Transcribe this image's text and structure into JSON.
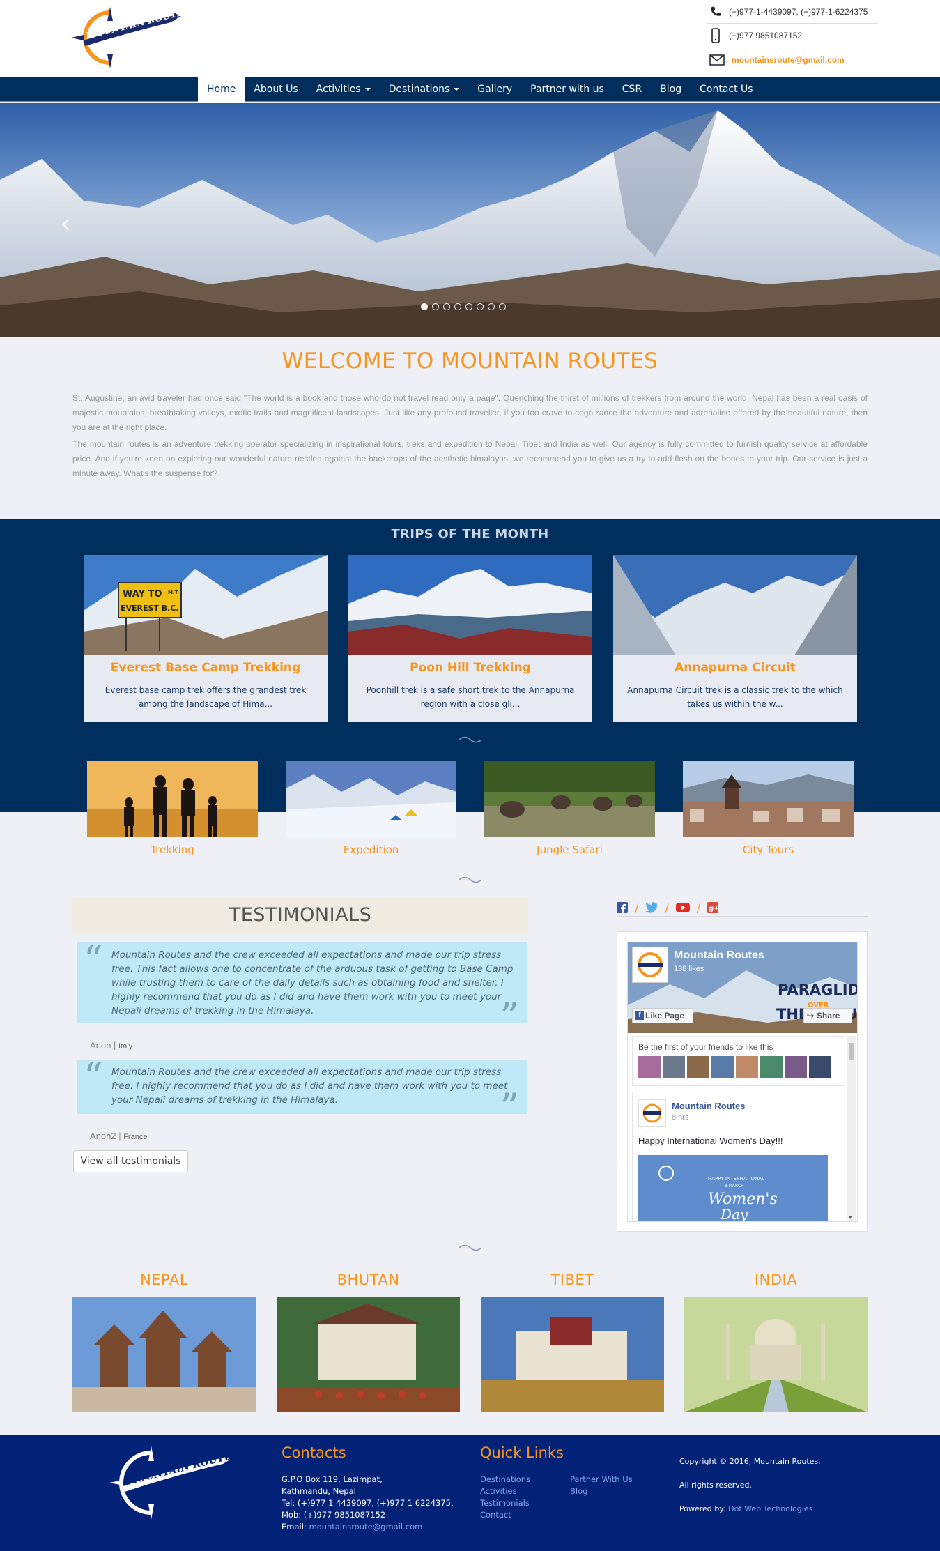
{
  "header": {
    "logo_text": "MOUNTAIN ROUTES",
    "phone_land": "(+)977-1-4439097, (+)977-1-6224375",
    "phone_mobile": "(+)977 9851087152",
    "email": "mountainsroute@gmail.com"
  },
  "nav": {
    "items": [
      {
        "label": "Home",
        "active": true
      },
      {
        "label": "About Us"
      },
      {
        "label": "Activities",
        "dropdown": true
      },
      {
        "label": "Destinations",
        "dropdown": true
      },
      {
        "label": "Gallery"
      },
      {
        "label": "Partner with us"
      },
      {
        "label": "CSR"
      },
      {
        "label": "Blog"
      },
      {
        "label": "Contact Us"
      }
    ]
  },
  "hero": {
    "slides": 8,
    "active_slide": 1
  },
  "welcome": {
    "title": "WELCOME TO MOUNTAIN ROUTES",
    "para1": "St. Augustine, an avid traveler had once said \"The world is a book and those who do not travel read only a page\". Quenching the thirst of millions of trekkers from around the world, Nepal has been a real oasis of majestic mountains, breathtaking valleys, exotic trails and magnificent landscapes. Just like any profound traveller, if you too crave to cognizance the adventure and adrenaline offered by the beautiful nature, then you are at the right place.",
    "para2": "The mountain routes is an adventure trekking operator specializing in inspirational tours, treks and expedition to Nepal, Tibet and India as well. Our agency is fully committed to furnish quality service at affordable price. And if you're keen on exploring our wonderful nature nestled against the backdrops of the aesthetic himalayas, we recommend you to give us a try to add flesh on the bones to your trip. Our service is just a minute away. What's the suspense for?"
  },
  "trips": {
    "title": "TRIPS OF THE MONTH",
    "items": [
      {
        "title": "Everest Base Camp Trekking",
        "desc": "Everest base camp trek offers the grandest trek among the landscape of Hima...",
        "sign_line1": "WAY TO",
        "sign_line2": "EVEREST B.C.",
        "sign_mt": "M.T"
      },
      {
        "title": "Poon Hill Trekking",
        "desc": "Poonhill trek is a safe short trek to the Annapurna region with a close gli..."
      },
      {
        "title": "Annapurna Circuit",
        "desc": "Annapurna Circuit trek is a classic trek to the which takes us within the w..."
      }
    ]
  },
  "activities": [
    {
      "label": "Trekking"
    },
    {
      "label": "Expedition"
    },
    {
      "label": "Jungle Safari"
    },
    {
      "label": "City Tours"
    }
  ],
  "testimonials": {
    "title": "TESTIMONIALS",
    "items": [
      {
        "text": "Mountain Routes and the crew exceeded all expectations and made our trip stress free. This fact allows one to concentrate of the arduous task of getting to Base Camp while trusting them to care of the daily details such as obtaining food and shelter. I highly recommend that you do as I did and have them work with you to meet your Nepali dreams of trekking in the Himalaya.",
        "author": "Anon",
        "country": "Italy"
      },
      {
        "text": "Mountain Routes and the crew exceeded all expectations and made our trip stress free. I highly recommend that you do as I did and have them work with you to meet your Nepali dreams of trekking in the Himalaya.",
        "author": "Anon2",
        "country": "France"
      }
    ],
    "view_all": "View all testimonials"
  },
  "facebook": {
    "page_name": "Mountain Routes",
    "likes": "138 likes",
    "like_btn": "Like Page",
    "share_btn": "Share",
    "cover_text1": "PARAGLIDE",
    "cover_text2": "OVER",
    "cover_text3": "THE CLOUDS",
    "friends_text": "Be the first of your friends to like this",
    "post_author": "Mountain Routes",
    "post_time": "8 hrs",
    "post_text": "Happy International Women's Day!!!",
    "post_img_text1": "HAPPY INTERNATIONAL",
    "post_img_text2": "8 MARCH",
    "post_img_text3": "Women's",
    "post_img_text4": "Day"
  },
  "countries": [
    {
      "label": "NEPAL"
    },
    {
      "label": "BHUTAN"
    },
    {
      "label": "TIBET"
    },
    {
      "label": "INDIA"
    }
  ],
  "footer": {
    "contacts_title": "Contacts",
    "address1": "G.P.O Box 119, Lazimpat,",
    "address2": "Kathmandu, Nepal",
    "tel": "Tel: (+)977 1 4439097, (+)977 1 6224375,",
    "mob": "Mob: (+)977 9851087152",
    "email_label": "Email:",
    "email": "mountainsroute@gmail.com",
    "quick_title": "Quick Links",
    "links_col1": [
      "Destinations",
      "Activities",
      "Testimonials",
      "Contact"
    ],
    "links_col2": [
      "Partner With Us",
      "Blog"
    ],
    "copyright": "Copyright © 2016, Mountain Routes.",
    "rights": "All rights reserved.",
    "powered_label": "Powered by:",
    "powered_by": "Dot Web Technologies"
  },
  "colors": {
    "accent": "#f7941d",
    "navy": "#002e5d",
    "footer": "#022278"
  }
}
